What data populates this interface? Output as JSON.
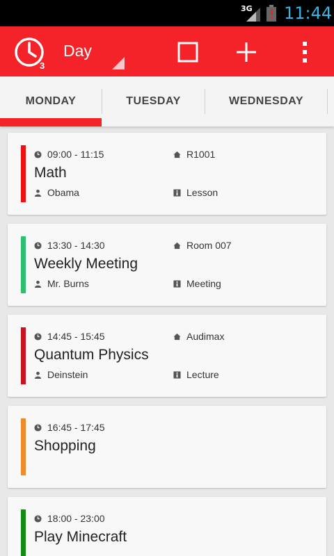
{
  "status_bar": {
    "network": "3G",
    "time": "11:44"
  },
  "action_bar": {
    "app_badge": "3",
    "view_mode": "Day"
  },
  "tabs": [
    {
      "label": "MONDAY",
      "selected": true
    },
    {
      "label": "TUESDAY",
      "selected": false
    },
    {
      "label": "WEDNESDAY",
      "selected": false
    }
  ],
  "events": [
    {
      "time": "09:00 - 11:15",
      "title": "Math",
      "location": "R1001",
      "person": "Obama",
      "type": "Lesson",
      "color": "#ee1111"
    },
    {
      "time": "13:30 - 14:30",
      "title": "Weekly Meeting",
      "location": "Room 007",
      "person": "Mr. Burns",
      "type": "Meeting",
      "color": "#2fbf71"
    },
    {
      "time": "14:45 - 15:45",
      "title": "Quantum Physics",
      "location": "Audimax",
      "person": "Deinstein",
      "type": "Lecture",
      "color": "#c8141e"
    },
    {
      "time": "16:45 - 17:45",
      "title": "Shopping",
      "color": "#f08c28"
    },
    {
      "time": "18:00 - 23:00",
      "title": "Play Minecraft",
      "color": "#148c14"
    }
  ],
  "colors": {
    "primary": "#f4232a",
    "clock": "#33b5e5"
  }
}
